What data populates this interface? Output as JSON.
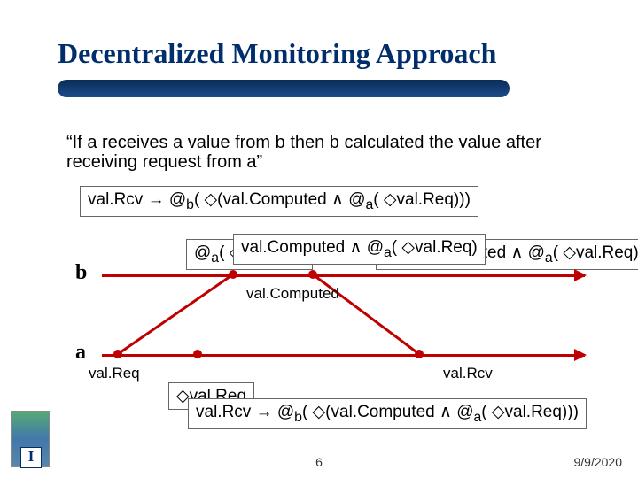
{
  "title": "Decentralized Monitoring Approach",
  "desc": "“If a receives a value from b then b calculated the value after receiving request from a”",
  "formula_top": "val.Rcv → @",
  "formula_top_sub1": "b",
  "formula_top_mid": "( ◇(val.Computed ∧ @",
  "formula_top_sub2": "a",
  "formula_top_end": "( ◇val.Req)))",
  "mid_left_pre": "@",
  "mid_left_sub": "a",
  "mid_left_rest": "( ◇val.Req)",
  "mid_center": "val.Computed ∧ @",
  "mid_center_sub": "a",
  "mid_center_end": "( ◇val.Req)",
  "mid_right_pre": "◇(val.Computed ∧ @",
  "mid_right_sub": "a",
  "mid_right_end": "( ◇val.Req))",
  "axis_b": "b",
  "axis_a": "a",
  "lbl_valReq": "val.Req",
  "lbl_valComputed": "val.Computed",
  "lbl_valRcv": "val.Rcv",
  "bottom_small": "◇val.Req",
  "bottom_full_pre": "val.Rcv → @",
  "bottom_full_sub1": "b",
  "bottom_full_mid": "( ◇(val.Computed ∧ @",
  "bottom_full_sub2": "a",
  "bottom_full_end": "( ◇val.Req)))",
  "page": "6",
  "date": "9/9/2020"
}
